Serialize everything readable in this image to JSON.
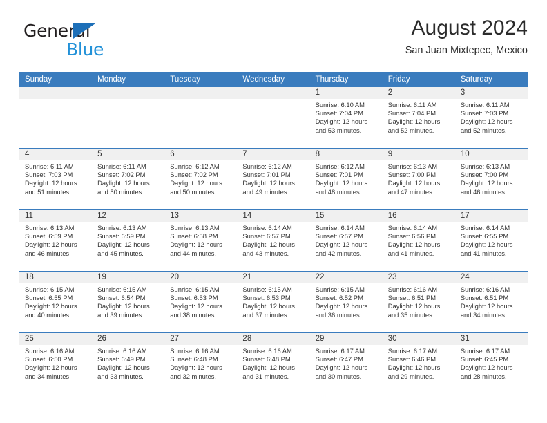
{
  "brand": {
    "name_part1": "General",
    "name_part2": "Blue",
    "logo_icon": "triangle-logo-icon"
  },
  "header": {
    "month_title": "August 2024",
    "location": "San Juan Mixtepec, Mexico"
  },
  "colors": {
    "header_blue": "#3a7cbe",
    "brand_dark": "#231f20",
    "brand_blue": "#2291d8",
    "daynum_band": "#f0f0f0",
    "text": "#333333"
  },
  "calendar": {
    "weekday_headers": [
      "Sunday",
      "Monday",
      "Tuesday",
      "Wednesday",
      "Thursday",
      "Friday",
      "Saturday"
    ],
    "weeks": [
      [
        {
          "blank": true
        },
        {
          "blank": true
        },
        {
          "blank": true
        },
        {
          "blank": true
        },
        {
          "day": "1",
          "sunrise": "Sunrise: 6:10 AM",
          "sunset": "Sunset: 7:04 PM",
          "daylight1": "Daylight: 12 hours",
          "daylight2": "and 53 minutes."
        },
        {
          "day": "2",
          "sunrise": "Sunrise: 6:11 AM",
          "sunset": "Sunset: 7:04 PM",
          "daylight1": "Daylight: 12 hours",
          "daylight2": "and 52 minutes."
        },
        {
          "day": "3",
          "sunrise": "Sunrise: 6:11 AM",
          "sunset": "Sunset: 7:03 PM",
          "daylight1": "Daylight: 12 hours",
          "daylight2": "and 52 minutes."
        }
      ],
      [
        {
          "day": "4",
          "sunrise": "Sunrise: 6:11 AM",
          "sunset": "Sunset: 7:03 PM",
          "daylight1": "Daylight: 12 hours",
          "daylight2": "and 51 minutes."
        },
        {
          "day": "5",
          "sunrise": "Sunrise: 6:11 AM",
          "sunset": "Sunset: 7:02 PM",
          "daylight1": "Daylight: 12 hours",
          "daylight2": "and 50 minutes."
        },
        {
          "day": "6",
          "sunrise": "Sunrise: 6:12 AM",
          "sunset": "Sunset: 7:02 PM",
          "daylight1": "Daylight: 12 hours",
          "daylight2": "and 50 minutes."
        },
        {
          "day": "7",
          "sunrise": "Sunrise: 6:12 AM",
          "sunset": "Sunset: 7:01 PM",
          "daylight1": "Daylight: 12 hours",
          "daylight2": "and 49 minutes."
        },
        {
          "day": "8",
          "sunrise": "Sunrise: 6:12 AM",
          "sunset": "Sunset: 7:01 PM",
          "daylight1": "Daylight: 12 hours",
          "daylight2": "and 48 minutes."
        },
        {
          "day": "9",
          "sunrise": "Sunrise: 6:13 AM",
          "sunset": "Sunset: 7:00 PM",
          "daylight1": "Daylight: 12 hours",
          "daylight2": "and 47 minutes."
        },
        {
          "day": "10",
          "sunrise": "Sunrise: 6:13 AM",
          "sunset": "Sunset: 7:00 PM",
          "daylight1": "Daylight: 12 hours",
          "daylight2": "and 46 minutes."
        }
      ],
      [
        {
          "day": "11",
          "sunrise": "Sunrise: 6:13 AM",
          "sunset": "Sunset: 6:59 PM",
          "daylight1": "Daylight: 12 hours",
          "daylight2": "and 46 minutes."
        },
        {
          "day": "12",
          "sunrise": "Sunrise: 6:13 AM",
          "sunset": "Sunset: 6:59 PM",
          "daylight1": "Daylight: 12 hours",
          "daylight2": "and 45 minutes."
        },
        {
          "day": "13",
          "sunrise": "Sunrise: 6:13 AM",
          "sunset": "Sunset: 6:58 PM",
          "daylight1": "Daylight: 12 hours",
          "daylight2": "and 44 minutes."
        },
        {
          "day": "14",
          "sunrise": "Sunrise: 6:14 AM",
          "sunset": "Sunset: 6:57 PM",
          "daylight1": "Daylight: 12 hours",
          "daylight2": "and 43 minutes."
        },
        {
          "day": "15",
          "sunrise": "Sunrise: 6:14 AM",
          "sunset": "Sunset: 6:57 PM",
          "daylight1": "Daylight: 12 hours",
          "daylight2": "and 42 minutes."
        },
        {
          "day": "16",
          "sunrise": "Sunrise: 6:14 AM",
          "sunset": "Sunset: 6:56 PM",
          "daylight1": "Daylight: 12 hours",
          "daylight2": "and 41 minutes."
        },
        {
          "day": "17",
          "sunrise": "Sunrise: 6:14 AM",
          "sunset": "Sunset: 6:55 PM",
          "daylight1": "Daylight: 12 hours",
          "daylight2": "and 41 minutes."
        }
      ],
      [
        {
          "day": "18",
          "sunrise": "Sunrise: 6:15 AM",
          "sunset": "Sunset: 6:55 PM",
          "daylight1": "Daylight: 12 hours",
          "daylight2": "and 40 minutes."
        },
        {
          "day": "19",
          "sunrise": "Sunrise: 6:15 AM",
          "sunset": "Sunset: 6:54 PM",
          "daylight1": "Daylight: 12 hours",
          "daylight2": "and 39 minutes."
        },
        {
          "day": "20",
          "sunrise": "Sunrise: 6:15 AM",
          "sunset": "Sunset: 6:53 PM",
          "daylight1": "Daylight: 12 hours",
          "daylight2": "and 38 minutes."
        },
        {
          "day": "21",
          "sunrise": "Sunrise: 6:15 AM",
          "sunset": "Sunset: 6:53 PM",
          "daylight1": "Daylight: 12 hours",
          "daylight2": "and 37 minutes."
        },
        {
          "day": "22",
          "sunrise": "Sunrise: 6:15 AM",
          "sunset": "Sunset: 6:52 PM",
          "daylight1": "Daylight: 12 hours",
          "daylight2": "and 36 minutes."
        },
        {
          "day": "23",
          "sunrise": "Sunrise: 6:16 AM",
          "sunset": "Sunset: 6:51 PM",
          "daylight1": "Daylight: 12 hours",
          "daylight2": "and 35 minutes."
        },
        {
          "day": "24",
          "sunrise": "Sunrise: 6:16 AM",
          "sunset": "Sunset: 6:51 PM",
          "daylight1": "Daylight: 12 hours",
          "daylight2": "and 34 minutes."
        }
      ],
      [
        {
          "day": "25",
          "sunrise": "Sunrise: 6:16 AM",
          "sunset": "Sunset: 6:50 PM",
          "daylight1": "Daylight: 12 hours",
          "daylight2": "and 34 minutes."
        },
        {
          "day": "26",
          "sunrise": "Sunrise: 6:16 AM",
          "sunset": "Sunset: 6:49 PM",
          "daylight1": "Daylight: 12 hours",
          "daylight2": "and 33 minutes."
        },
        {
          "day": "27",
          "sunrise": "Sunrise: 6:16 AM",
          "sunset": "Sunset: 6:48 PM",
          "daylight1": "Daylight: 12 hours",
          "daylight2": "and 32 minutes."
        },
        {
          "day": "28",
          "sunrise": "Sunrise: 6:16 AM",
          "sunset": "Sunset: 6:48 PM",
          "daylight1": "Daylight: 12 hours",
          "daylight2": "and 31 minutes."
        },
        {
          "day": "29",
          "sunrise": "Sunrise: 6:17 AM",
          "sunset": "Sunset: 6:47 PM",
          "daylight1": "Daylight: 12 hours",
          "daylight2": "and 30 minutes."
        },
        {
          "day": "30",
          "sunrise": "Sunrise: 6:17 AM",
          "sunset": "Sunset: 6:46 PM",
          "daylight1": "Daylight: 12 hours",
          "daylight2": "and 29 minutes."
        },
        {
          "day": "31",
          "sunrise": "Sunrise: 6:17 AM",
          "sunset": "Sunset: 6:45 PM",
          "daylight1": "Daylight: 12 hours",
          "daylight2": "and 28 minutes."
        }
      ]
    ]
  }
}
